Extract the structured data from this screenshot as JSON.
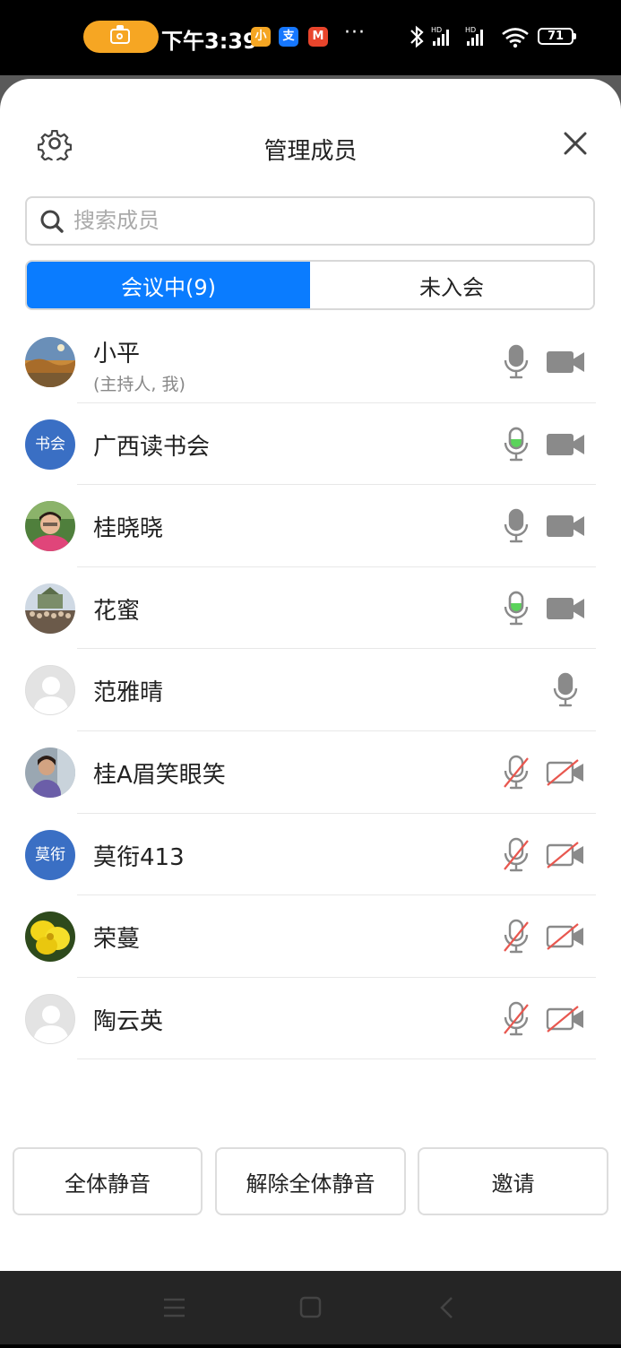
{
  "status_bar": {
    "time": "下午3:39",
    "battery": "71",
    "app_icons": [
      "小",
      "支",
      "M"
    ],
    "more": "···"
  },
  "header": {
    "title": "管理成员"
  },
  "search": {
    "placeholder": "搜索成员"
  },
  "tabs": [
    {
      "label": "会议中(9)",
      "active": true
    },
    {
      "label": "未入会",
      "active": false
    }
  ],
  "members": [
    {
      "name": "小平",
      "sub": "(主持人, 我)",
      "avatar": "photo-landscape",
      "mic": "on",
      "camera": "off"
    },
    {
      "name": "广西读书会",
      "avatar_text": "书会",
      "avatar": "text",
      "mic": "speaking",
      "camera": "off"
    },
    {
      "name": "桂晓晓",
      "avatar": "photo-portrait",
      "mic": "on",
      "camera": "off"
    },
    {
      "name": "花蜜",
      "avatar": "photo-group",
      "mic": "speaking",
      "camera": "off"
    },
    {
      "name": "范雅晴",
      "avatar": "default",
      "mic": "on",
      "camera": "none"
    },
    {
      "name": "桂A眉笑眼笑",
      "avatar": "photo-person",
      "mic": "muted",
      "camera": "disabled"
    },
    {
      "name": "莫衔413",
      "avatar_text": "莫衔",
      "avatar": "text",
      "mic": "muted",
      "camera": "disabled"
    },
    {
      "name": "荣蔓",
      "avatar": "photo-flower",
      "mic": "muted",
      "camera": "disabled"
    },
    {
      "name": "陶云英",
      "avatar": "default",
      "mic": "muted",
      "camera": "disabled"
    }
  ],
  "actions": {
    "mute_all": "全体静音",
    "unmute_all": "解除全体静音",
    "invite": "邀请"
  },
  "colors": {
    "accent": "#0a7cff",
    "speaking": "#5bd35b",
    "muted_slash": "#e8574f",
    "icon_gray": "#8a8a8a"
  }
}
